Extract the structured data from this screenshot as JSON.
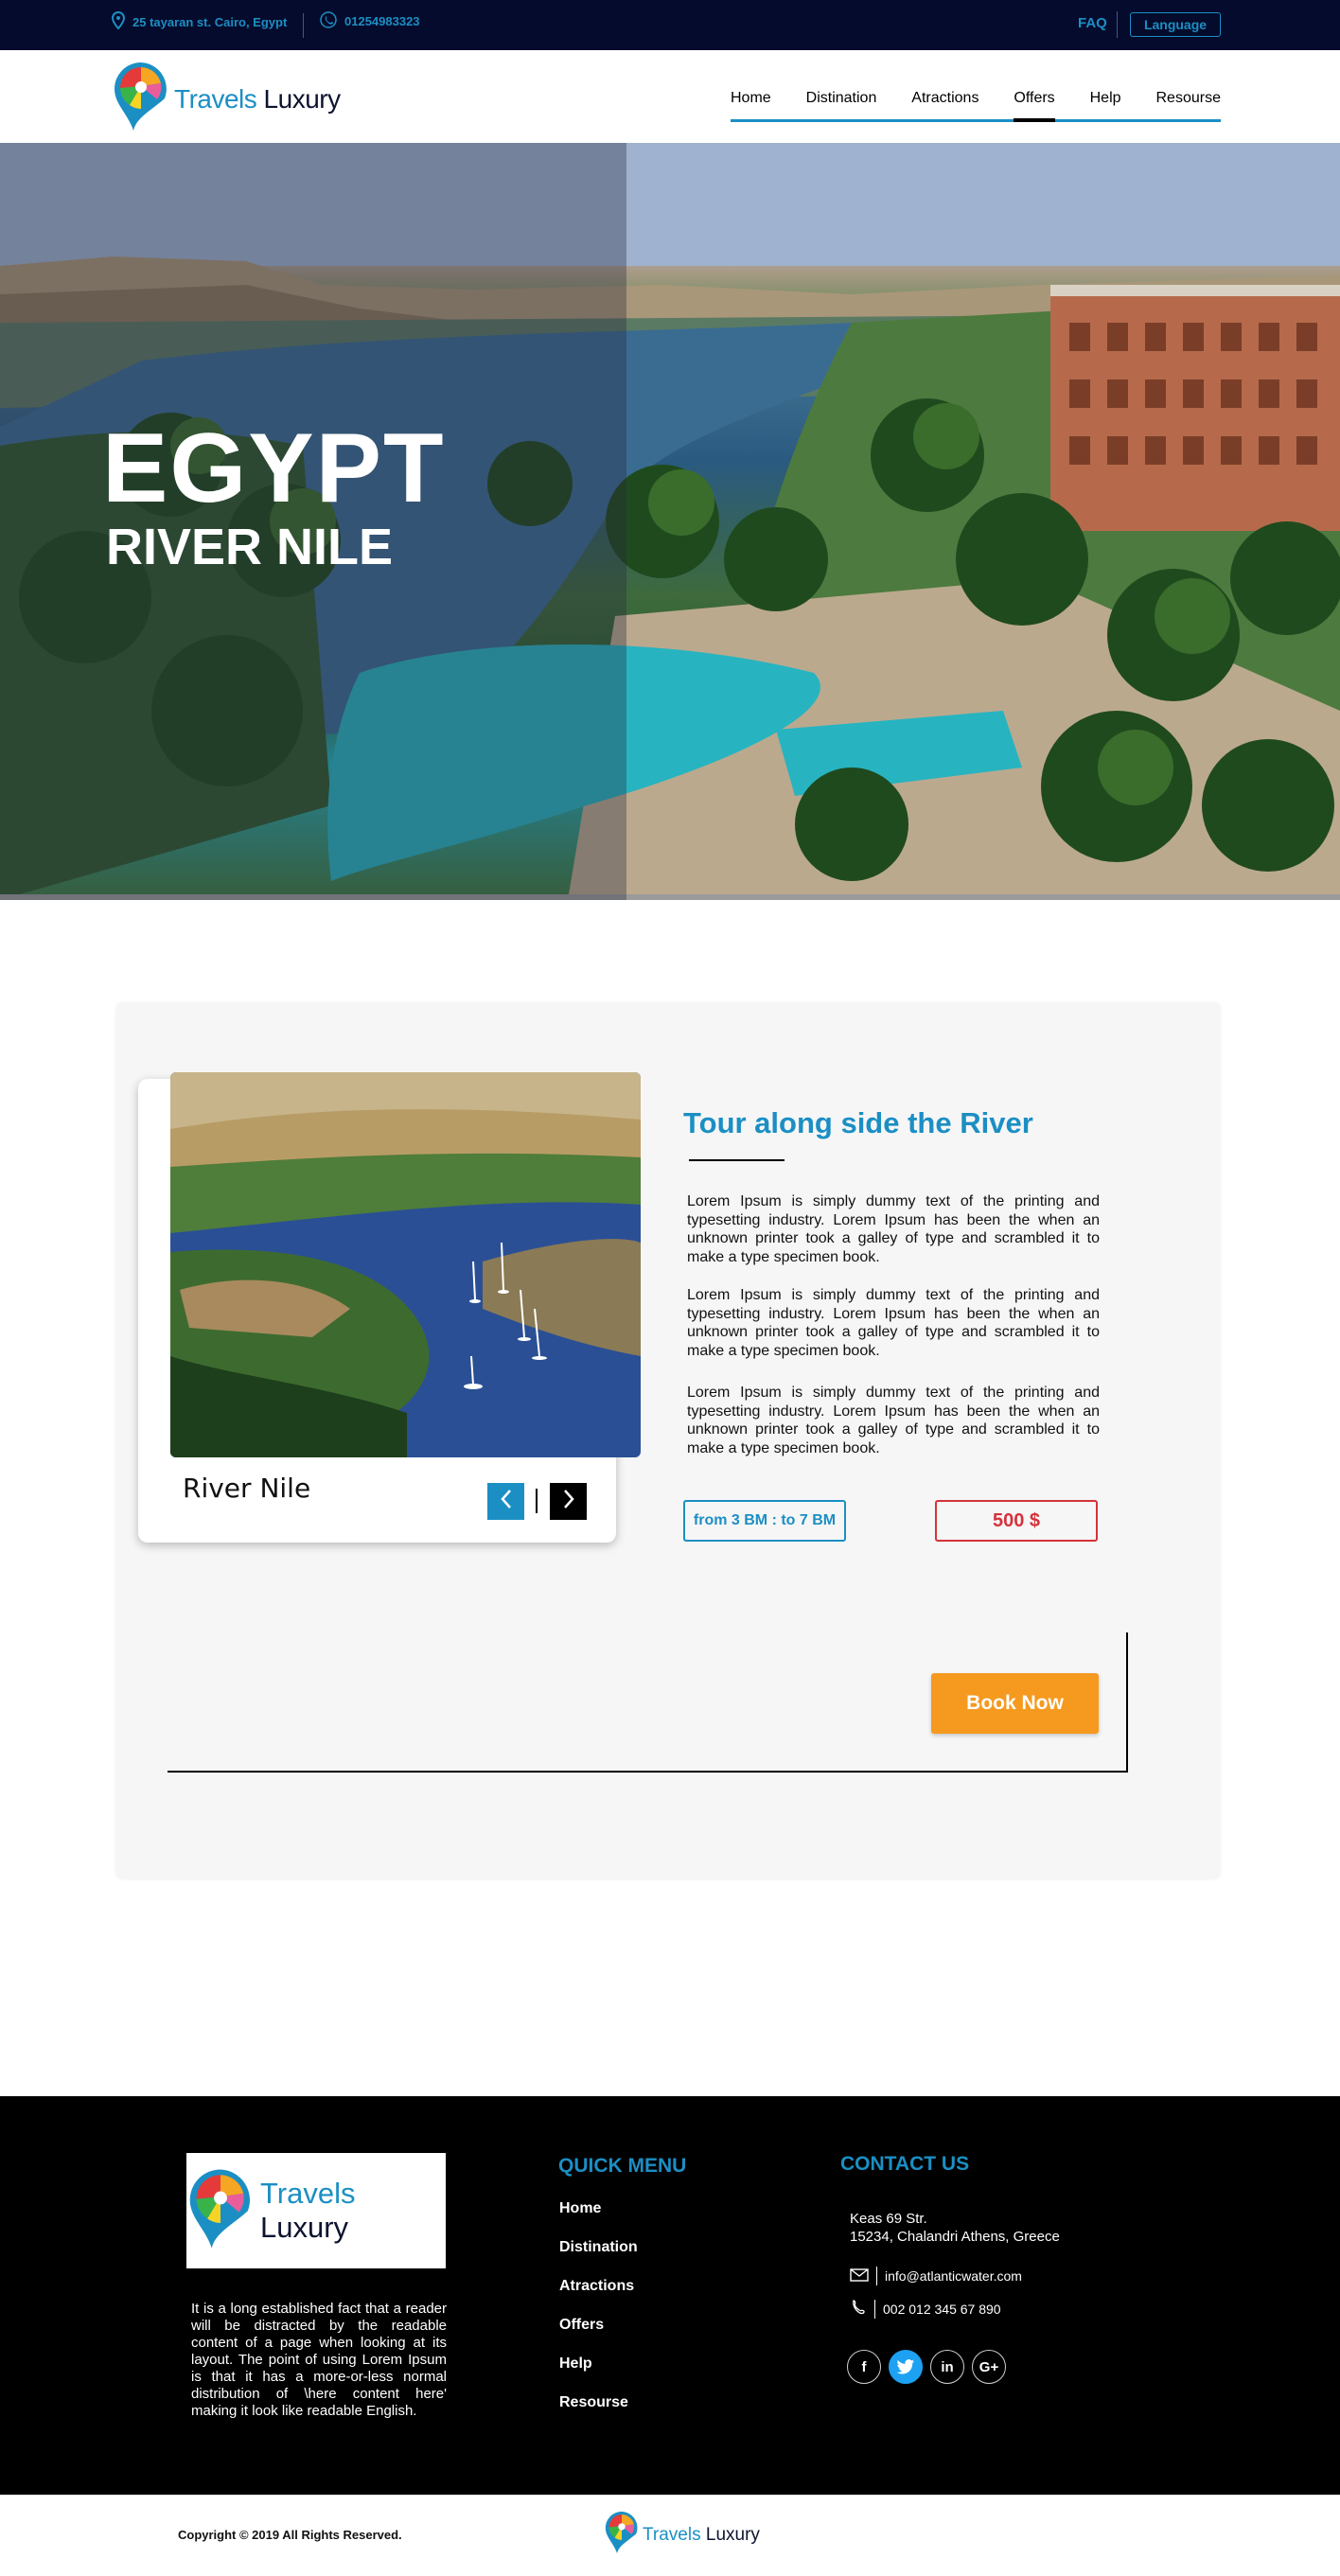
{
  "topbar": {
    "address": "25 tayaran st. Cairo, Egypt",
    "phone": "01254983323",
    "faq": "FAQ",
    "language": "Language"
  },
  "brand": {
    "part1": "Travels",
    "part2": "Luxury"
  },
  "nav": {
    "items": [
      {
        "label": "Home"
      },
      {
        "label": "Distination"
      },
      {
        "label": "Atractions"
      },
      {
        "label": "Offers"
      },
      {
        "label": "Help"
      },
      {
        "label": "Resourse"
      }
    ],
    "active": "Offers"
  },
  "hero": {
    "title": "EGYPT",
    "subtitle": "RIVER NILE"
  },
  "tour": {
    "photo_caption": "River Nile",
    "title": "Tour along side the River",
    "paragraphs": [
      "Lorem Ipsum is simply dummy text of the printing and typesetting industry. Lorem Ipsum has been the when an unknown printer took a galley of type and scrambled it to make a type specimen book.",
      "Lorem Ipsum is simply dummy text of the printing and typesetting industry. Lorem Ipsum has been the when an unknown printer took a galley of type and scrambled it to make a type specimen book.",
      "Lorem Ipsum is simply dummy text of the printing and typesetting industry. Lorem Ipsum has been the when an unknown printer took a galley of type and scrambled it to make a type specimen book."
    ],
    "time": "from 3 BM : to 7 BM",
    "price": "500 $",
    "book_label": "Book Now"
  },
  "footer": {
    "about": "It is a long established fact that a reader will be distracted by the readable content of a page when looking at its layout. The point of using Lorem Ipsum is that it has a more-or-less normal distribution of \\here content here' making it look like readable English.",
    "quick_menu_title": "QUICK MENU",
    "quick_menu": [
      "Home",
      "Distination",
      "Atractions",
      "Offers",
      "Help",
      "Resourse"
    ],
    "contact_title": "CONTACT US",
    "address_line1": "Keas 69 Str.",
    "address_line2": "15234, Chalandri Athens, Greece",
    "email": "info@atlanticwater.com",
    "phone": "002 012 345 67 890",
    "socials": [
      "facebook-icon",
      "twitter-icon",
      "linkedin-icon",
      "google-plus-icon"
    ],
    "social_labels": {
      "facebook": "f",
      "linkedin": "in",
      "google": "G+"
    },
    "copyright": "Copyright © 2019 All Rights Reserved."
  },
  "colors": {
    "accent": "#1b8fc4",
    "topbar_bg": "#050b2c",
    "price": "#d5323b",
    "book": "#f59a1f",
    "footer_bg": "#000000"
  }
}
